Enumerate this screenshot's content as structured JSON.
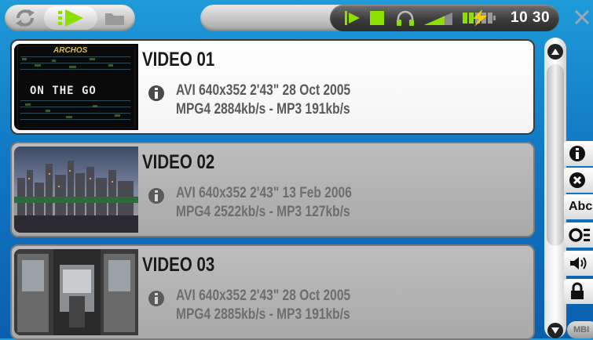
{
  "colors": {
    "background": "#1178c4",
    "accent_green": "#8be000",
    "selected_row": "#ffffff",
    "unselected_row": "#b0b0b0",
    "battery_bolt": "#f5d000"
  },
  "top_bar": {
    "buttons": [
      {
        "icon": "repeat-icon",
        "active": false
      },
      {
        "icon": "play-queue-icon",
        "active": true
      },
      {
        "icon": "folder-icon",
        "active": false
      }
    ],
    "status": {
      "play_state_icon": "play-icon",
      "volume_icon": "volume-bar-icon",
      "headphones_icon": "headphones-icon",
      "signal_icon": "signal-strength-icon",
      "battery_icon": "battery-charging-icon",
      "time": "10 30"
    },
    "close_icon": "close-icon"
  },
  "videos": [
    {
      "title": "VIDEO 01",
      "info_line1": "AVI 640x352 2'43\" 28 Oct 2005",
      "info_line2": "MPG4 2884kb/s - MP3 191kb/s",
      "thumbnail_text": "ON THE GO",
      "thumbnail_brand": "ARCHOS",
      "selected": true
    },
    {
      "title": "VIDEO 02",
      "info_line1": "AVI 640x352 2'43\" 13 Feb 2006",
      "info_line2": "MPG4 2522kb/s - MP3 127kb/s",
      "selected": false
    },
    {
      "title": "VIDEO 03",
      "info_line1": "AVI 640x352 2'43\" 28 Oct 2005",
      "info_line2": "MPG4 2885kb/s - MP3 191kb/s",
      "selected": false
    }
  ],
  "side_menu": [
    {
      "icon": "info-icon"
    },
    {
      "icon": "delete-icon"
    },
    {
      "icon": "rename-icon",
      "label": "Abc"
    },
    {
      "icon": "options-icon"
    },
    {
      "icon": "sound-icon"
    },
    {
      "icon": "lock-icon"
    }
  ],
  "bottom_label": "MBI"
}
